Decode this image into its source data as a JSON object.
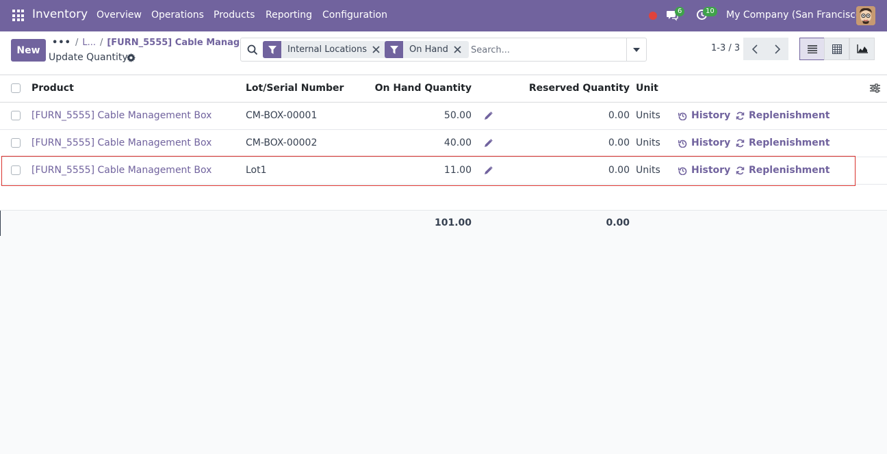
{
  "navbar": {
    "app_name": "Inventory",
    "menu": [
      "Overview",
      "Operations",
      "Products",
      "Reporting",
      "Configuration"
    ],
    "messages_count": "6",
    "activities_count": "10",
    "company": "My Company (San Francisco)"
  },
  "breadcrumb": {
    "dots": "•••",
    "first": "L...",
    "current": "[FURN_5555] Cable Manage..."
  },
  "page": {
    "title": "Update Quantity",
    "new_button": "New"
  },
  "search": {
    "facets": [
      "Internal Locations",
      "On Hand"
    ],
    "placeholder": "Search..."
  },
  "pager": {
    "value": "1-3 / 3"
  },
  "table": {
    "columns": {
      "product": "Product",
      "lot": "Lot/Serial Number",
      "on_hand": "On Hand Quantity",
      "reserved": "Reserved Quantity",
      "unit": "Unit"
    },
    "rows": [
      {
        "product": "[FURN_5555] Cable Management Box",
        "lot": "CM-BOX-00001",
        "on_hand": "50.00",
        "reserved": "0.00",
        "unit": "Units",
        "history": "History",
        "replenishment": "Replenishment"
      },
      {
        "product": "[FURN_5555] Cable Management Box",
        "lot": "CM-BOX-00002",
        "on_hand": "40.00",
        "reserved": "0.00",
        "unit": "Units",
        "history": "History",
        "replenishment": "Replenishment"
      },
      {
        "product": "[FURN_5555] Cable Management Box",
        "lot": "Lot1",
        "on_hand": "11.00",
        "reserved": "0.00",
        "unit": "Units",
        "history": "History",
        "replenishment": "Replenishment"
      }
    ],
    "totals": {
      "on_hand": "101.00",
      "reserved": "0.00"
    }
  },
  "colors": {
    "brand": "#71639e",
    "highlight": "#d9302c",
    "badge": "#3fa24a"
  }
}
